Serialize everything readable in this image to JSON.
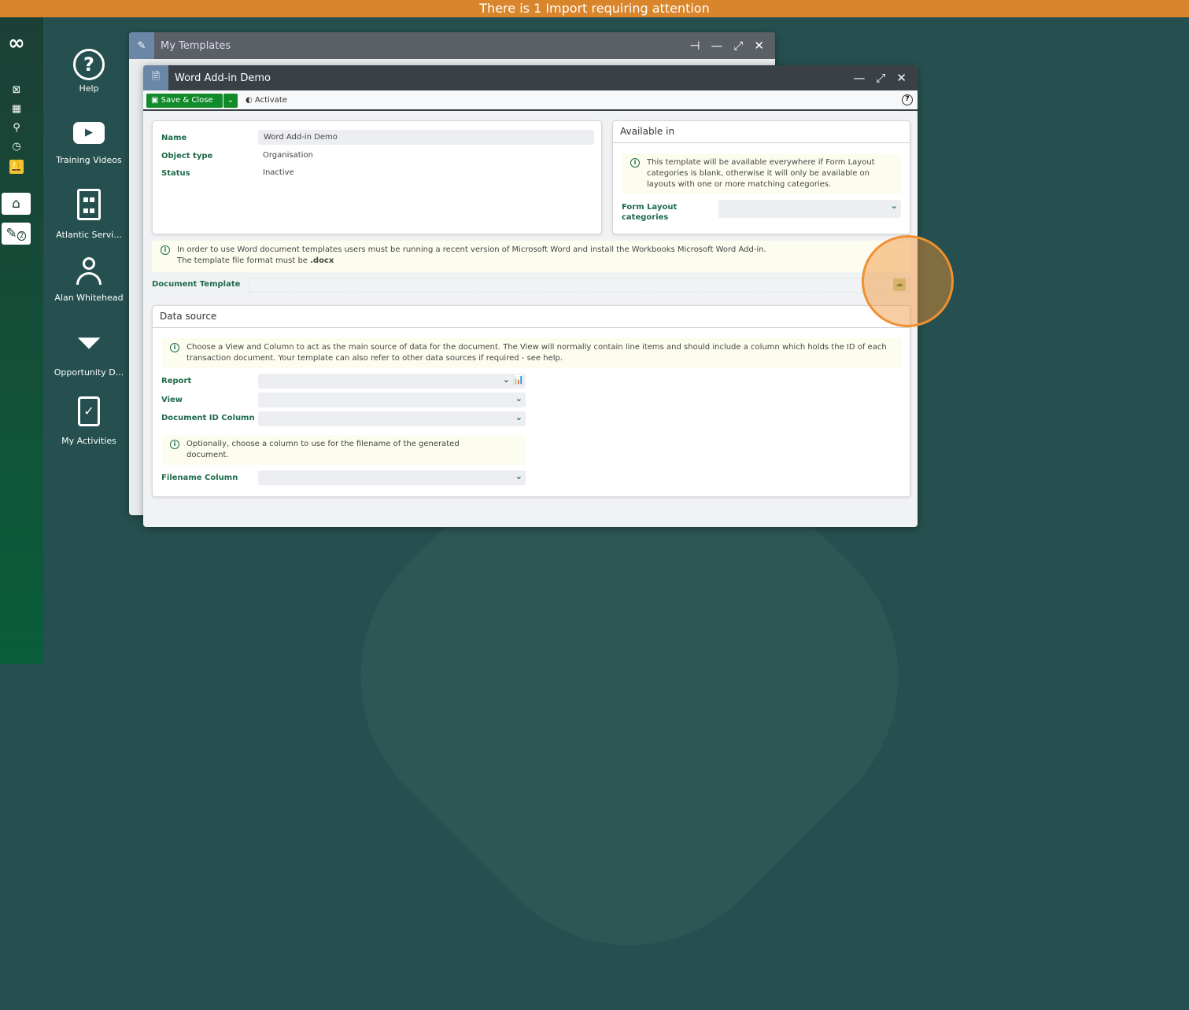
{
  "banner": {
    "text": "There is 1 Import requiring attention"
  },
  "desktop": [
    {
      "label": "Help",
      "icon": "help-icon"
    },
    {
      "label": "Training Videos",
      "icon": "play-icon"
    },
    {
      "label": "Atlantic Servi...",
      "icon": "building-icon"
    },
    {
      "label": "Alan Whitehead",
      "icon": "person-icon"
    },
    {
      "label": "Opportunity D...",
      "icon": "filter-icon"
    },
    {
      "label": "My Activities",
      "icon": "clipboard-icon"
    }
  ],
  "sidebar": {
    "badge": "2"
  },
  "bg_window": {
    "title": "My Templates"
  },
  "window": {
    "title": "Word Add-in Demo",
    "toolbar": {
      "save": "Save & Close",
      "activate": "Activate"
    },
    "details": {
      "name_label": "Name",
      "name": "Word Add-in Demo",
      "type_label": "Object type",
      "type": "Organisation",
      "status_label": "Status",
      "status": "Inactive"
    },
    "available": {
      "title": "Available in",
      "info": "This template will be available everywhere if Form Layout categories is blank, otherwise it will only be available on layouts with one or more matching categories.",
      "cat_label": "Form Layout categories"
    },
    "word_info": {
      "text": "In order to use Word document templates users must be running a recent version of Microsoft Word and install the Workbooks Microsoft Word Add-in.",
      "text2": "The template file format must be ",
      "ext": ".docx"
    },
    "doc_template_label": "Document Template",
    "datasource": {
      "title": "Data source",
      "info": "Choose a View and Column to act as the main source of data for the document. The View will normally contain line items and should include a column which holds the ID of each transaction document. Your template can also refer to other data sources if required - see help.",
      "report": "Report",
      "view": "View",
      "docid": "Document ID Column",
      "info2": "Optionally, choose a column to use for the filename of the generated document.",
      "filename": "Filename Column"
    }
  },
  "colors": {
    "banner": "#d9852c",
    "accent": "#1e6a4a",
    "save": "#118a2a",
    "highlight": "#f0902f"
  }
}
